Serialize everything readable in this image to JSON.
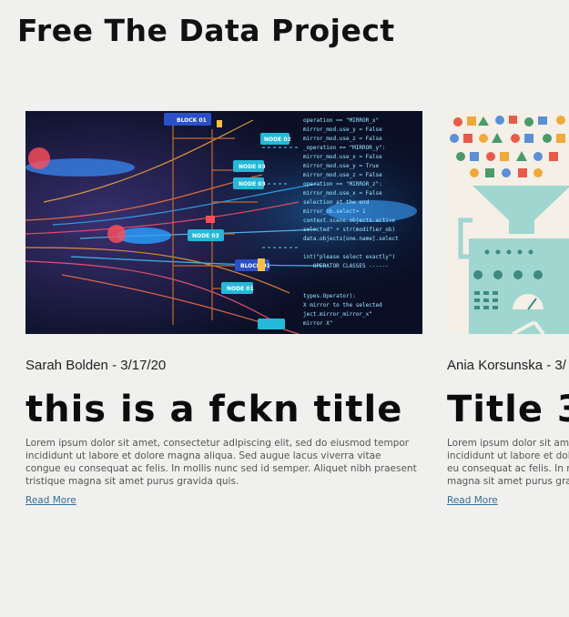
{
  "site": {
    "title": "Free The Data Project"
  },
  "posts": [
    {
      "meta": "Sarah Bolden - 3/17/20",
      "title": "this is a fckn title",
      "excerpt": "Lorem ipsum dolor sit amet, consectetur adipiscing elit, sed do eiusmod tempor incididunt ut labore et dolore magna aliqua. Sed augue lacus viverra vitae congue eu consequat ac felis. In mollis nunc sed id semper. Aliquet nibh praesent tristique magna sit amet purus gravida quis.",
      "read_more": "Read More",
      "image_icon": "data-network-image",
      "node_labels": [
        "BLOCK 01",
        "NODE 02",
        "NODE 03",
        "NODE 03",
        "BLOCK 01",
        "NODE 03",
        "NODE 01"
      ]
    },
    {
      "meta": "Ania Korsunska - 3/",
      "title": "Title 3",
      "excerpt_lines": [
        "Lorem ipsum dolor sit am",
        "incididunt ut labore et dol",
        "eu consequat ac felis. In m",
        "magna sit amet purus gra"
      ],
      "read_more": "Read More",
      "image_icon": "data-funnel-machine-image"
    }
  ],
  "colors": {
    "background": "#f0f0ee",
    "link": "#356e94",
    "teal": "#9fd6cf"
  }
}
